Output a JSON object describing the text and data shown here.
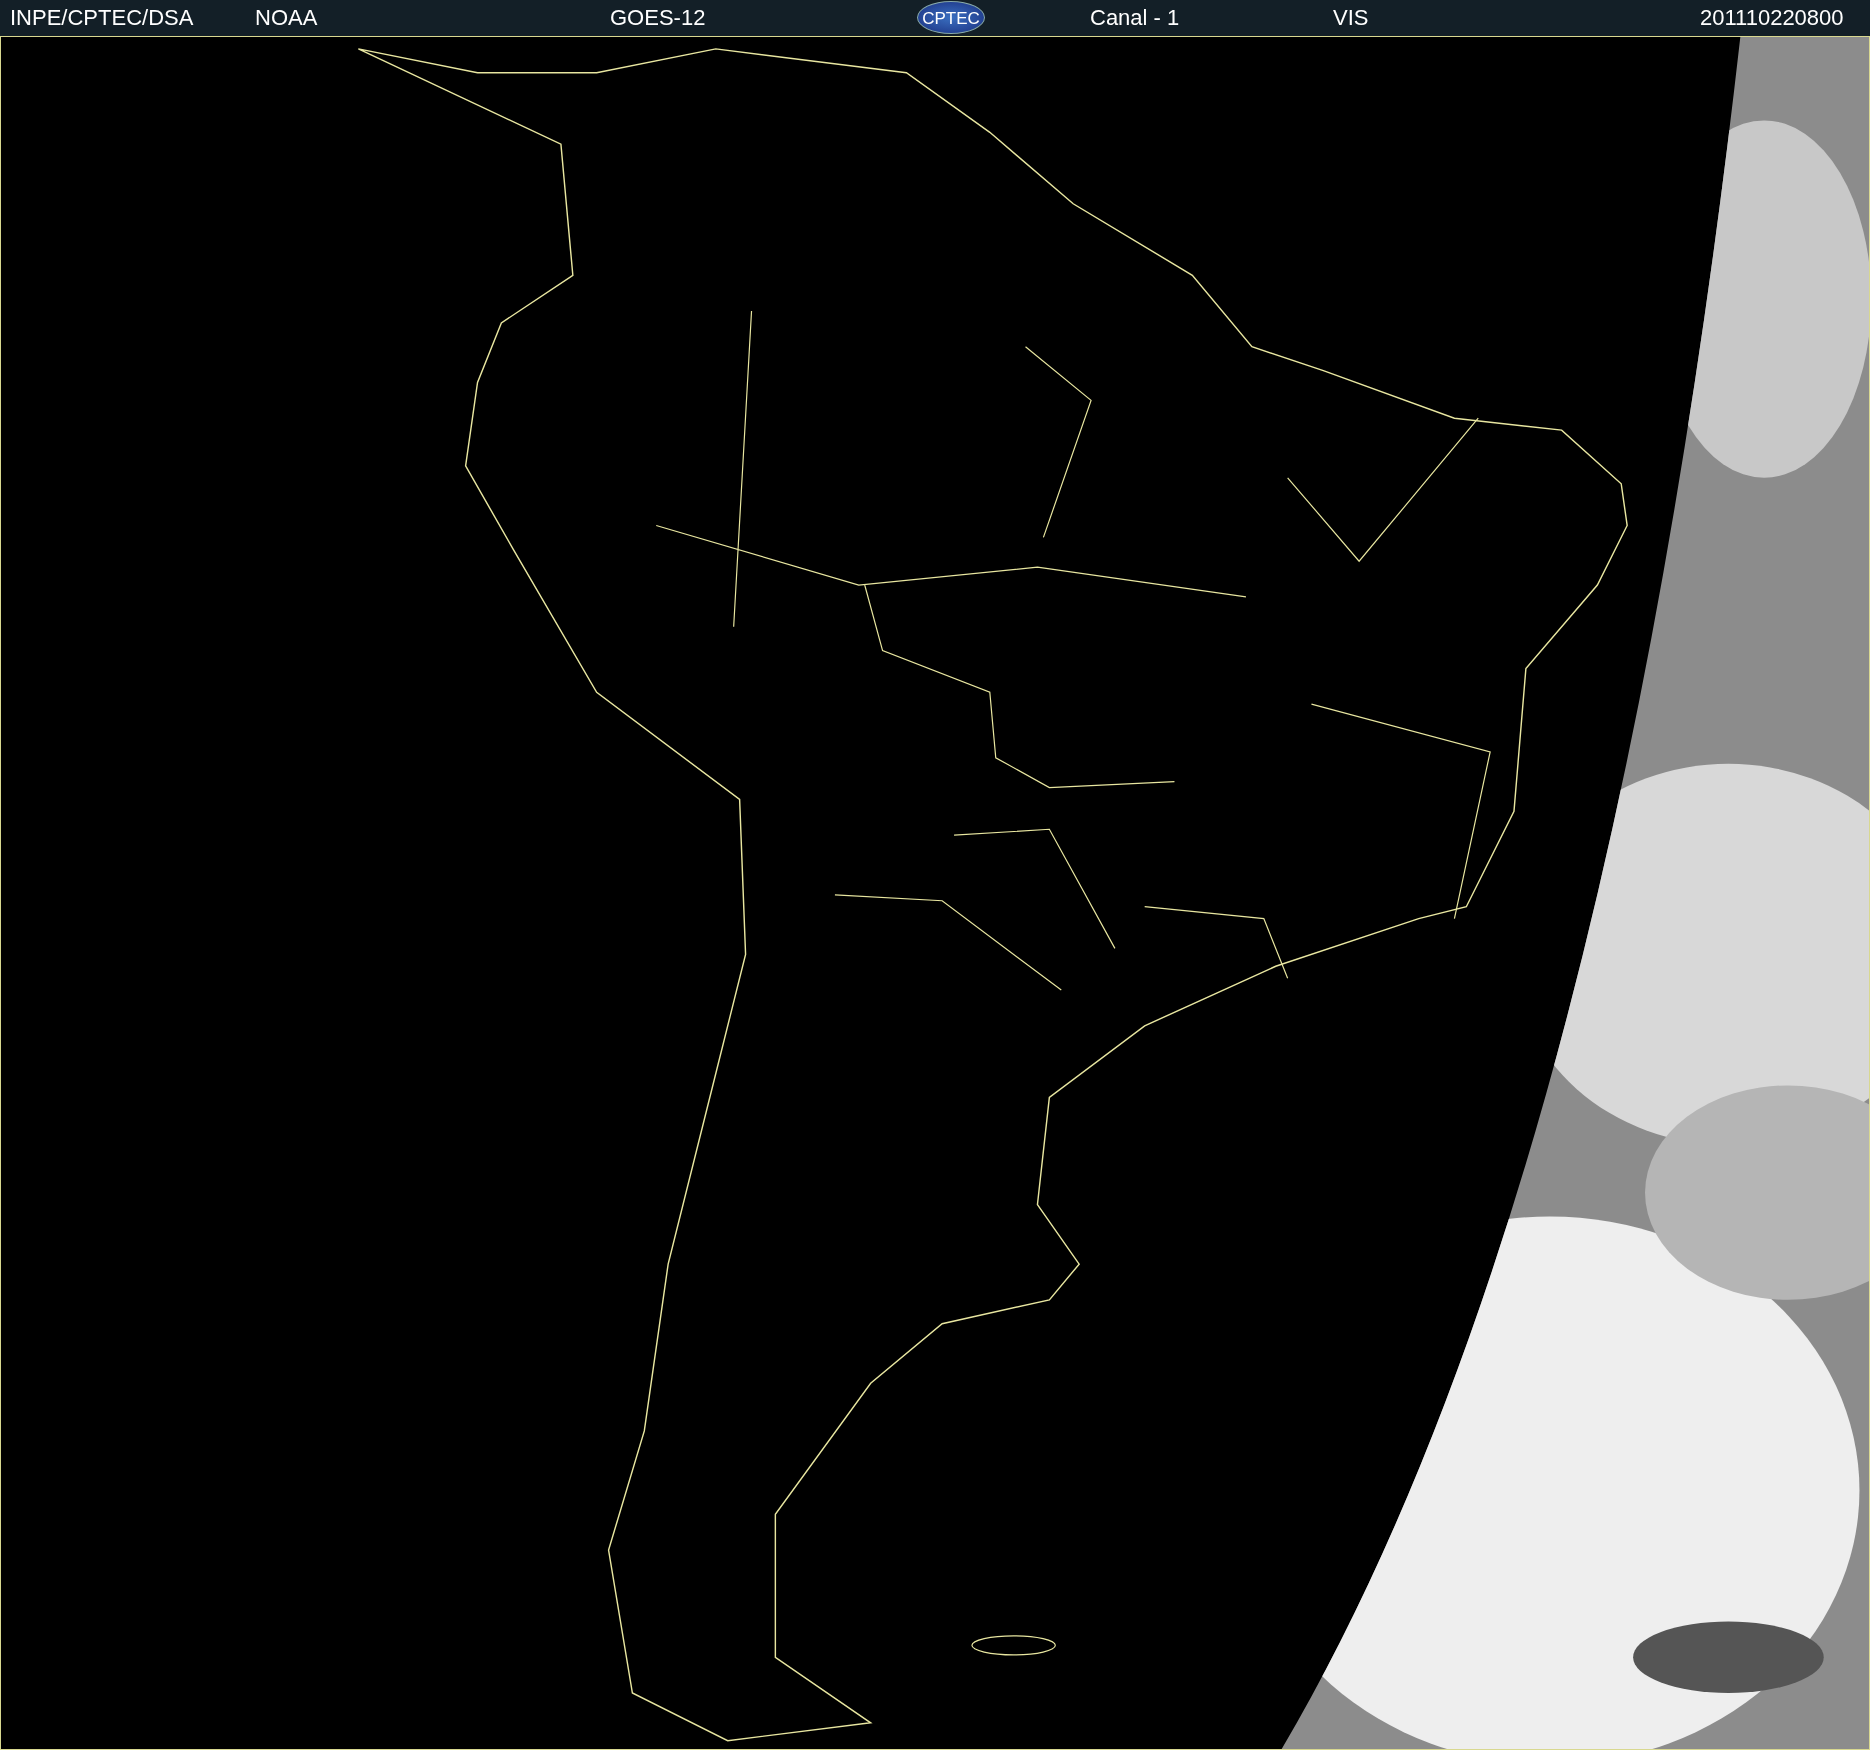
{
  "header": {
    "items": [
      {
        "kind": "text",
        "text": "INPE/CPTEC/DSA"
      },
      {
        "kind": "text",
        "text": "NOAA"
      },
      {
        "kind": "text",
        "text": "GOES-12"
      },
      {
        "kind": "logo",
        "text": "CPTEC"
      },
      {
        "kind": "text",
        "text": "Canal - 1"
      },
      {
        "kind": "text",
        "text": "VIS"
      },
      {
        "kind": "text",
        "text": "201110220800"
      }
    ]
  }
}
